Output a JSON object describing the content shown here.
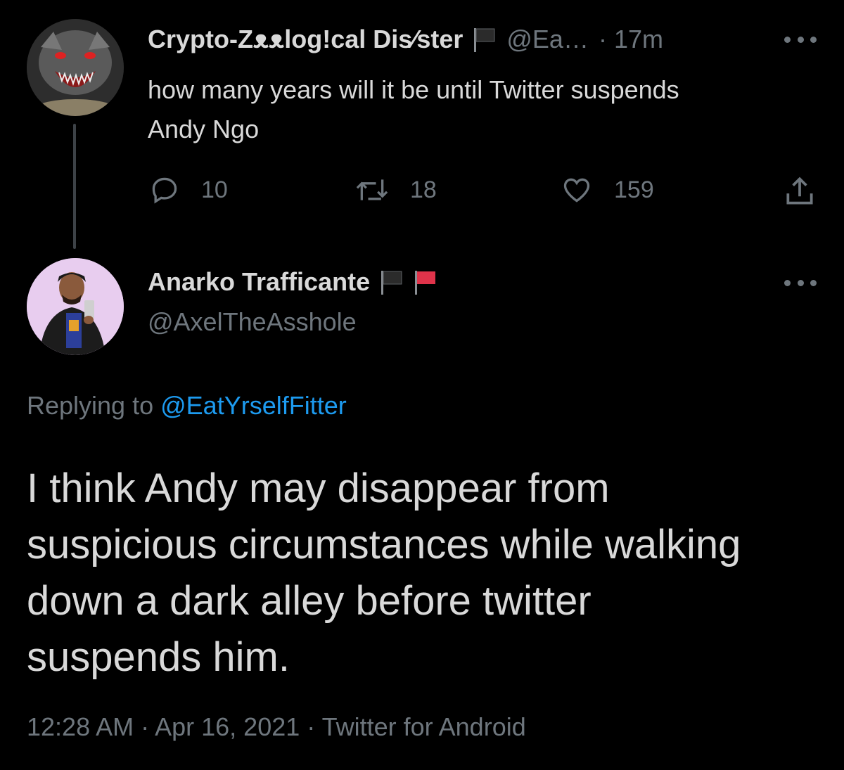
{
  "parent_tweet": {
    "display_name": "Crypto-Zᴥᴥlog!cal Dis⁄ster",
    "handle": "@Ea…",
    "time": "· 17m",
    "text_line1": "how many years will it be until Twitter suspends",
    "text_line2": "Andy Ngo",
    "reply_count": "10",
    "retweet_count": "18",
    "like_count": "159",
    "flags": [
      "black-flag"
    ]
  },
  "reply_tweet": {
    "display_name": "Anarko Trafficante",
    "handle": "@AxelTheAsshole",
    "flags": [
      "black-flag",
      "red-flag"
    ],
    "replying_prefix": "Replying to",
    "replying_to": "@EatYrselfFitter",
    "text_line1": "I think Andy may disappear from",
    "text_line2": "suspicious circumstances while walking",
    "text_line3": "down a dark alley before twitter",
    "text_line4": "suspends him.",
    "timestamp": "12:28 AM · Apr 16, 2021 · Twitter for Android"
  },
  "colors": {
    "background": "#000000",
    "text": "#d9d9d9",
    "muted": "#6e767d",
    "link": "#1d9bf0",
    "thread_line": "#3d4247",
    "red_flag": "#e0334a"
  },
  "icons": {
    "reply": "speech-bubble-icon",
    "retweet": "retweet-icon",
    "like": "heart-icon",
    "share": "share-icon",
    "more": "more-dots-icon"
  }
}
